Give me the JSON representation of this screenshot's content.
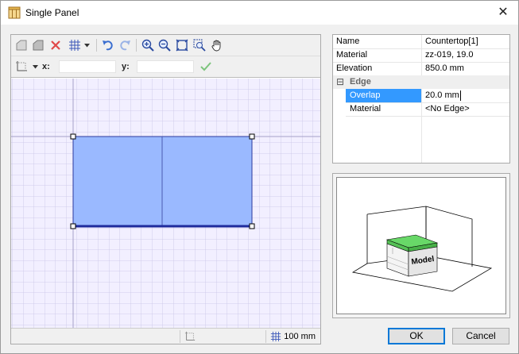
{
  "window": {
    "title": "Single Panel",
    "close_glyph": "✕"
  },
  "toolbar": {
    "icons": [
      "panel-add-icon",
      "panel-edit-icon",
      "delete-icon",
      "grid-icon",
      "undo-icon",
      "redo-icon",
      "zoom-in-icon",
      "zoom-out-icon",
      "zoom-fit-icon",
      "zoom-window-icon",
      "pan-hand-icon"
    ],
    "x_label": "x:",
    "y_label": "y:",
    "x_value": "",
    "y_value": ""
  },
  "statusbar": {
    "grid_size": "100 mm"
  },
  "properties": {
    "rows": [
      {
        "name": "Name",
        "value": "Countertop[1]"
      },
      {
        "name": "Material",
        "value": "zz-019, 19.0"
      },
      {
        "name": "Elevation",
        "value": "850.0 mm"
      }
    ],
    "group": {
      "toggle": "⊟",
      "label": "Edge"
    },
    "edge_rows": [
      {
        "name": "Overlap",
        "value": "20.0 mm",
        "selected": true
      },
      {
        "name": "Material",
        "value": "<No Edge>",
        "selected": false
      }
    ]
  },
  "preview": {
    "model_label": "Model"
  },
  "buttons": {
    "ok": "OK",
    "cancel": "Cancel"
  },
  "colors": {
    "panel_fill": "#9ab9ff",
    "panel_edge": "#1f2b9c",
    "grid_line": "#c9c3e6",
    "canvas_bg": "#f2efff",
    "selection_bg": "#3399ff",
    "preview_top": "#68d868"
  }
}
